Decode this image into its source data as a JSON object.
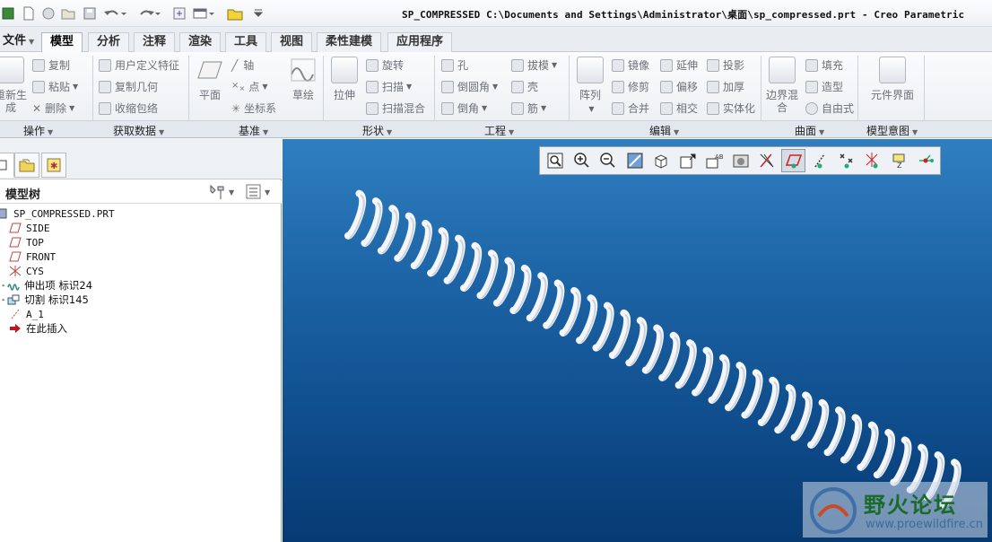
{
  "window": {
    "title": "SP_COMPRESSED C:\\Documents and Settings\\Administrator\\桌面\\sp_compressed.prt - Creo Parametric"
  },
  "quick_access": {
    "icons": [
      "app-icon",
      "new-icon",
      "open-icon",
      "folder-icon",
      "save-icon",
      "undo-icon",
      "redo-icon",
      "regenerate-icon",
      "window-icon",
      "close-window-icon",
      "customize-icon"
    ]
  },
  "ribbon": {
    "tabs": [
      {
        "label": "文件",
        "active": false
      },
      {
        "label": "模型",
        "active": true
      },
      {
        "label": "分析",
        "active": false
      },
      {
        "label": "注释",
        "active": false
      },
      {
        "label": "渲染",
        "active": false
      },
      {
        "label": "工具",
        "active": false
      },
      {
        "label": "视图",
        "active": false
      },
      {
        "label": "柔性建模",
        "active": false
      },
      {
        "label": "应用程序",
        "active": false
      }
    ],
    "groups": {
      "operations": {
        "label": "操作",
        "items": [
          "重新生成",
          "复制",
          "粘贴",
          "删除"
        ]
      },
      "get_data": {
        "label": "获取数据",
        "items": [
          "用户定义特征",
          "复制几何",
          "收缩包络"
        ]
      },
      "datum": {
        "label": "基准",
        "items": [
          "平面",
          "轴",
          "点",
          "坐标系",
          "草绘"
        ]
      },
      "shapes": {
        "label": "形状",
        "items": [
          "拉伸",
          "旋转",
          "扫描",
          "扫描混合"
        ]
      },
      "engineering": {
        "label": "工程",
        "items": [
          "孔",
          "拔模",
          "倒圆角",
          "壳",
          "倒角",
          "筋"
        ]
      },
      "editing": {
        "label": "编辑",
        "items": [
          "阵列",
          "镜像",
          "延伸",
          "投影",
          "修剪",
          "偏移",
          "加厚",
          "合并",
          "相交",
          "实体化"
        ]
      },
      "surfaces": {
        "label": "曲面",
        "items": [
          "边界混合",
          "填充",
          "造型",
          "自由式"
        ]
      },
      "model_intent": {
        "label": "模型意图",
        "items": [
          "元件界面"
        ]
      }
    }
  },
  "model_tree": {
    "title": "模型树",
    "items": [
      {
        "label": "SP_COMPRESSED.PRT",
        "icon": "part-icon"
      },
      {
        "label": "SIDE",
        "icon": "datum-plane-icon"
      },
      {
        "label": "TOP",
        "icon": "datum-plane-icon"
      },
      {
        "label": "FRONT",
        "icon": "datum-plane-icon"
      },
      {
        "label": "CYS",
        "icon": "coordinate-system-icon"
      },
      {
        "label": "伸出项 标识24",
        "icon": "protrusion-icon"
      },
      {
        "label": "切割 标识145",
        "icon": "cut-icon"
      },
      {
        "label": "A_1",
        "icon": "datum-axis-icon"
      },
      {
        "label": "在此插入",
        "icon": "insert-here-arrow-icon"
      }
    ]
  },
  "graphics_toolbar": {
    "icons": [
      "refit-icon",
      "zoom-in-icon",
      "zoom-out-icon",
      "repaint-icon",
      "display-style-icon",
      "saved-orientations-icon",
      "view-manager-icon",
      "perspective-icon",
      "datum-display-filter-icon",
      "plane-display-icon",
      "axis-display-icon",
      "point-display-icon",
      "csys-display-icon",
      "annotation-display-icon",
      "spin-center-icon"
    ]
  },
  "watermark": {
    "text": "野火论坛",
    "url": "www.proewildfire.cn"
  },
  "colors": {
    "graphics_top": "#2f7fc0",
    "graphics_bottom": "#063a72",
    "spring": "#f4f6fa"
  }
}
